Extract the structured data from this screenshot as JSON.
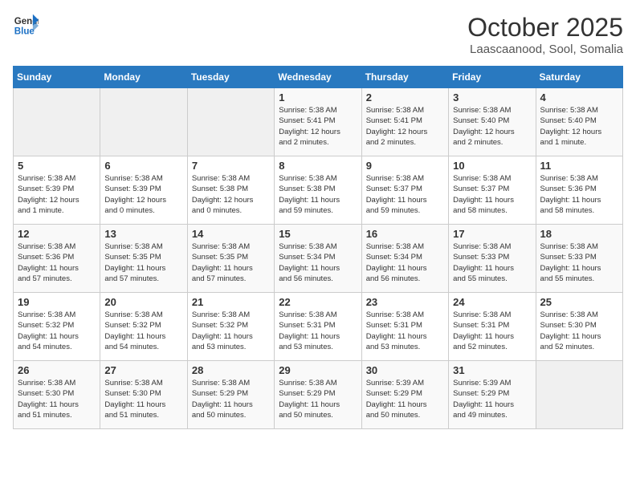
{
  "header": {
    "logo_line1": "General",
    "logo_line2": "Blue",
    "month": "October 2025",
    "location": "Laascaanood, Sool, Somalia"
  },
  "weekdays": [
    "Sunday",
    "Monday",
    "Tuesday",
    "Wednesday",
    "Thursday",
    "Friday",
    "Saturday"
  ],
  "weeks": [
    [
      {
        "day": "",
        "info": ""
      },
      {
        "day": "",
        "info": ""
      },
      {
        "day": "",
        "info": ""
      },
      {
        "day": "1",
        "info": "Sunrise: 5:38 AM\nSunset: 5:41 PM\nDaylight: 12 hours\nand 2 minutes."
      },
      {
        "day": "2",
        "info": "Sunrise: 5:38 AM\nSunset: 5:41 PM\nDaylight: 12 hours\nand 2 minutes."
      },
      {
        "day": "3",
        "info": "Sunrise: 5:38 AM\nSunset: 5:40 PM\nDaylight: 12 hours\nand 2 minutes."
      },
      {
        "day": "4",
        "info": "Sunrise: 5:38 AM\nSunset: 5:40 PM\nDaylight: 12 hours\nand 1 minute."
      }
    ],
    [
      {
        "day": "5",
        "info": "Sunrise: 5:38 AM\nSunset: 5:39 PM\nDaylight: 12 hours\nand 1 minute."
      },
      {
        "day": "6",
        "info": "Sunrise: 5:38 AM\nSunset: 5:39 PM\nDaylight: 12 hours\nand 0 minutes."
      },
      {
        "day": "7",
        "info": "Sunrise: 5:38 AM\nSunset: 5:38 PM\nDaylight: 12 hours\nand 0 minutes."
      },
      {
        "day": "8",
        "info": "Sunrise: 5:38 AM\nSunset: 5:38 PM\nDaylight: 11 hours\nand 59 minutes."
      },
      {
        "day": "9",
        "info": "Sunrise: 5:38 AM\nSunset: 5:37 PM\nDaylight: 11 hours\nand 59 minutes."
      },
      {
        "day": "10",
        "info": "Sunrise: 5:38 AM\nSunset: 5:37 PM\nDaylight: 11 hours\nand 58 minutes."
      },
      {
        "day": "11",
        "info": "Sunrise: 5:38 AM\nSunset: 5:36 PM\nDaylight: 11 hours\nand 58 minutes."
      }
    ],
    [
      {
        "day": "12",
        "info": "Sunrise: 5:38 AM\nSunset: 5:36 PM\nDaylight: 11 hours\nand 57 minutes."
      },
      {
        "day": "13",
        "info": "Sunrise: 5:38 AM\nSunset: 5:35 PM\nDaylight: 11 hours\nand 57 minutes."
      },
      {
        "day": "14",
        "info": "Sunrise: 5:38 AM\nSunset: 5:35 PM\nDaylight: 11 hours\nand 57 minutes."
      },
      {
        "day": "15",
        "info": "Sunrise: 5:38 AM\nSunset: 5:34 PM\nDaylight: 11 hours\nand 56 minutes."
      },
      {
        "day": "16",
        "info": "Sunrise: 5:38 AM\nSunset: 5:34 PM\nDaylight: 11 hours\nand 56 minutes."
      },
      {
        "day": "17",
        "info": "Sunrise: 5:38 AM\nSunset: 5:33 PM\nDaylight: 11 hours\nand 55 minutes."
      },
      {
        "day": "18",
        "info": "Sunrise: 5:38 AM\nSunset: 5:33 PM\nDaylight: 11 hours\nand 55 minutes."
      }
    ],
    [
      {
        "day": "19",
        "info": "Sunrise: 5:38 AM\nSunset: 5:32 PM\nDaylight: 11 hours\nand 54 minutes."
      },
      {
        "day": "20",
        "info": "Sunrise: 5:38 AM\nSunset: 5:32 PM\nDaylight: 11 hours\nand 54 minutes."
      },
      {
        "day": "21",
        "info": "Sunrise: 5:38 AM\nSunset: 5:32 PM\nDaylight: 11 hours\nand 53 minutes."
      },
      {
        "day": "22",
        "info": "Sunrise: 5:38 AM\nSunset: 5:31 PM\nDaylight: 11 hours\nand 53 minutes."
      },
      {
        "day": "23",
        "info": "Sunrise: 5:38 AM\nSunset: 5:31 PM\nDaylight: 11 hours\nand 53 minutes."
      },
      {
        "day": "24",
        "info": "Sunrise: 5:38 AM\nSunset: 5:31 PM\nDaylight: 11 hours\nand 52 minutes."
      },
      {
        "day": "25",
        "info": "Sunrise: 5:38 AM\nSunset: 5:30 PM\nDaylight: 11 hours\nand 52 minutes."
      }
    ],
    [
      {
        "day": "26",
        "info": "Sunrise: 5:38 AM\nSunset: 5:30 PM\nDaylight: 11 hours\nand 51 minutes."
      },
      {
        "day": "27",
        "info": "Sunrise: 5:38 AM\nSunset: 5:30 PM\nDaylight: 11 hours\nand 51 minutes."
      },
      {
        "day": "28",
        "info": "Sunrise: 5:38 AM\nSunset: 5:29 PM\nDaylight: 11 hours\nand 50 minutes."
      },
      {
        "day": "29",
        "info": "Sunrise: 5:38 AM\nSunset: 5:29 PM\nDaylight: 11 hours\nand 50 minutes."
      },
      {
        "day": "30",
        "info": "Sunrise: 5:39 AM\nSunset: 5:29 PM\nDaylight: 11 hours\nand 50 minutes."
      },
      {
        "day": "31",
        "info": "Sunrise: 5:39 AM\nSunset: 5:29 PM\nDaylight: 11 hours\nand 49 minutes."
      },
      {
        "day": "",
        "info": ""
      }
    ]
  ]
}
